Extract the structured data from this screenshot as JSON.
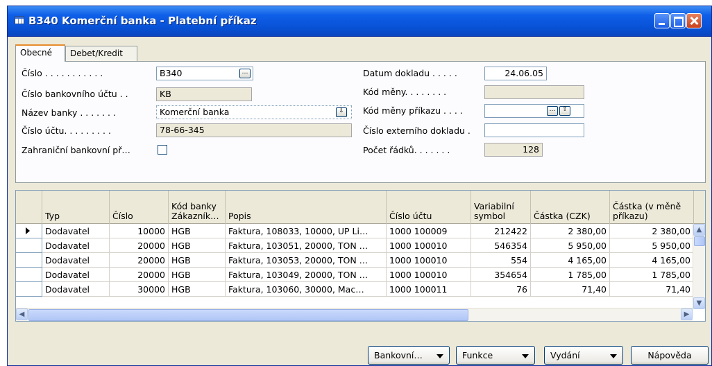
{
  "window": {
    "title": "B340 Komerční banka - Platební příkaz"
  },
  "tabs": [
    "Obecné",
    "Debet/Kredit"
  ],
  "form": {
    "cislo_label": "Číslo . . . . . . . . . . .",
    "cislo_value": "B340",
    "cislo_bu_label": "Číslo bankovního účtu . .",
    "cislo_bu_value": "KB",
    "nazev_banky_label": "Název banky . . . . . . .",
    "nazev_banky_value": "Komerční banka",
    "cislo_uctu_label": "Číslo účtu. . . . . . . . .",
    "cislo_uctu_value": "78-66-345",
    "zahranicni_label": "Zahraniční bankovní př…",
    "zahranicni_checked": false,
    "datum_label": "Datum dokladu . . . . .",
    "datum_value": "24.06.05",
    "kod_meny_label": "Kód měny. . . . . . . .",
    "kod_meny_value": "",
    "kod_meny_prikazu_label": "Kód měny příkazu . . . .",
    "kod_meny_prikazu_value": "",
    "cislo_ext_label": "Číslo externího dokladu .",
    "cislo_ext_value": "",
    "pocet_label": "Počet řádků. . . . . . .",
    "pocet_value": "128"
  },
  "table": {
    "headers": [
      "Typ",
      "Číslo",
      "Kód banky Zákazník…",
      "Popis",
      "Číslo účtu",
      "Variabilní symbol",
      "Částka (CZK)",
      "Částka (v měně příkazu)"
    ],
    "rows": [
      [
        "Dodavatel",
        "10000",
        "HGB",
        "Faktura, 108033, 10000, UP Li…",
        "1000 100009",
        "212422",
        "2 380,00",
        "2 380,00"
      ],
      [
        "Dodavatel",
        "20000",
        "HGB",
        "Faktura, 103051, 20000, TON …",
        "1000 100010",
        "546354",
        "5 950,00",
        "5 950,00"
      ],
      [
        "Dodavatel",
        "20000",
        "HGB",
        "Faktura, 103053, 20000, TON …",
        "1000 100010",
        "554",
        "4 165,00",
        "4 165,00"
      ],
      [
        "Dodavatel",
        "20000",
        "HGB",
        "Faktura, 103049, 20000, TON …",
        "1000 100010",
        "354654",
        "1 785,00",
        "1 785,00"
      ],
      [
        "Dodavatel",
        "30000",
        "HGB",
        "Faktura, 103060, 30000, Mac…",
        "1000 100011",
        "76",
        "71,40",
        "71,40"
      ]
    ]
  },
  "buttons": {
    "bankovni": "Bankovní…",
    "funkce": "Funkce",
    "vydani": "Vydání",
    "napoveda": "Nápověda"
  },
  "icons": {
    "ellipsis": "…",
    "dropdown": "▼"
  }
}
